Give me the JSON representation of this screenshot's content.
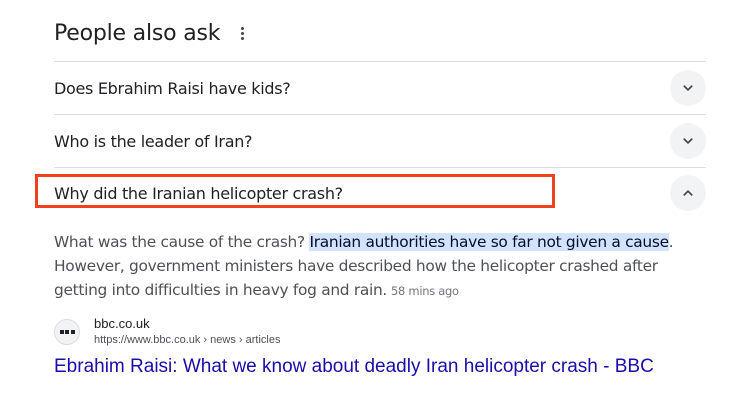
{
  "paa": {
    "title": "People also ask",
    "more_icon": "more-vert-icon",
    "questions": [
      {
        "text": "Does Ebrahim Raisi have kids?",
        "expanded": false,
        "icon": "chevron-down-icon"
      },
      {
        "text": "Who is the leader of Iran?",
        "expanded": false,
        "icon": "chevron-down-icon"
      },
      {
        "text": "Why did the Iranian helicopter crash?",
        "expanded": true,
        "icon": "chevron-up-icon"
      }
    ],
    "answer": {
      "lead": "What was the cause of the crash? ",
      "highlight": "Iranian authorities have so far not given a cause",
      "rest": ". However, government ministers have described how the helicopter crashed after getting into difficulties in heavy fog and rain.",
      "time": "58 mins ago"
    },
    "source": {
      "name": "bbc.co.uk",
      "url": "https://www.bbc.co.uk › news › articles",
      "favicon_icon": "bbc-favicon-icon"
    },
    "result_title": "Ebrahim Raisi: What we know about deadly Iran helicopter crash - BBC"
  },
  "colors": {
    "highlight_border": "#f1411c",
    "link": "#1a0dab",
    "text_highlight_bg": "#d3e3fd"
  }
}
